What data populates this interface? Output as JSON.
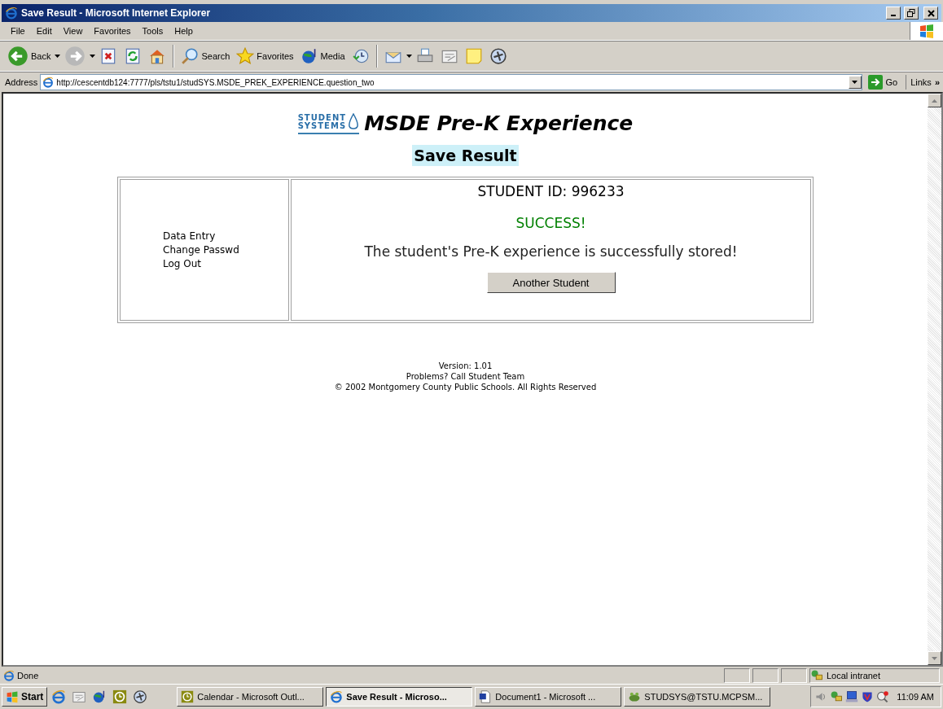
{
  "window": {
    "title": "Save Result - Microsoft Internet Explorer"
  },
  "menu": [
    "File",
    "Edit",
    "View",
    "Favorites",
    "Tools",
    "Help"
  ],
  "toolbar": [
    {
      "kind": "back",
      "label": "Back"
    },
    {
      "kind": "forward"
    },
    {
      "kind": "stop"
    },
    {
      "kind": "refresh"
    },
    {
      "kind": "home"
    },
    {
      "kind": "separator"
    },
    {
      "kind": "search",
      "label": "Search"
    },
    {
      "kind": "favorites",
      "label": "Favorites"
    },
    {
      "kind": "media",
      "label": "Media"
    },
    {
      "kind": "history"
    },
    {
      "kind": "separator"
    },
    {
      "kind": "mail"
    },
    {
      "kind": "print"
    },
    {
      "kind": "edit"
    },
    {
      "kind": "note"
    },
    {
      "kind": "messenger"
    }
  ],
  "address": {
    "label": "Address",
    "value": "http://cescentdb124:7777/pls/tstu1/studSYS.MSDE_PREK_EXPERIENCE.question_two",
    "go": "Go",
    "links": "Links",
    "links_more": "»"
  },
  "page": {
    "logo": {
      "line_1": "STUDENT",
      "line_2": "SYSTEMS"
    },
    "heading": "MSDE Pre-K Experience",
    "subheading": "Save Result",
    "nav": [
      "Data Entry",
      "Change Passwd",
      "Log Out"
    ],
    "student_id": "STUDENT ID: 996233",
    "status": "SUCCESS!",
    "message": "The student's Pre-K experience is successfully stored!",
    "button": "Another Student",
    "footer": [
      "Version: 1.01",
      "Problems? Call Student Team",
      "© 2002 Montgomery County Public Schools. All Rights Reserved"
    ]
  },
  "status_bar": {
    "text": "Done",
    "zone": "Local intranet"
  },
  "taskbar": {
    "start": "Start",
    "tasks": [
      {
        "kind": "calendar",
        "label": "Calendar - Microsoft Outl...",
        "selected": false
      },
      {
        "kind": "ie",
        "label": "Save Result - Microso...",
        "selected": true
      },
      {
        "kind": "word",
        "label": "Document1 - Microsoft ...",
        "selected": false
      },
      {
        "kind": "frog",
        "label": "STUDSYS@TSTU.MCPSM...",
        "selected": false
      }
    ],
    "clock": "11:09 AM"
  }
}
